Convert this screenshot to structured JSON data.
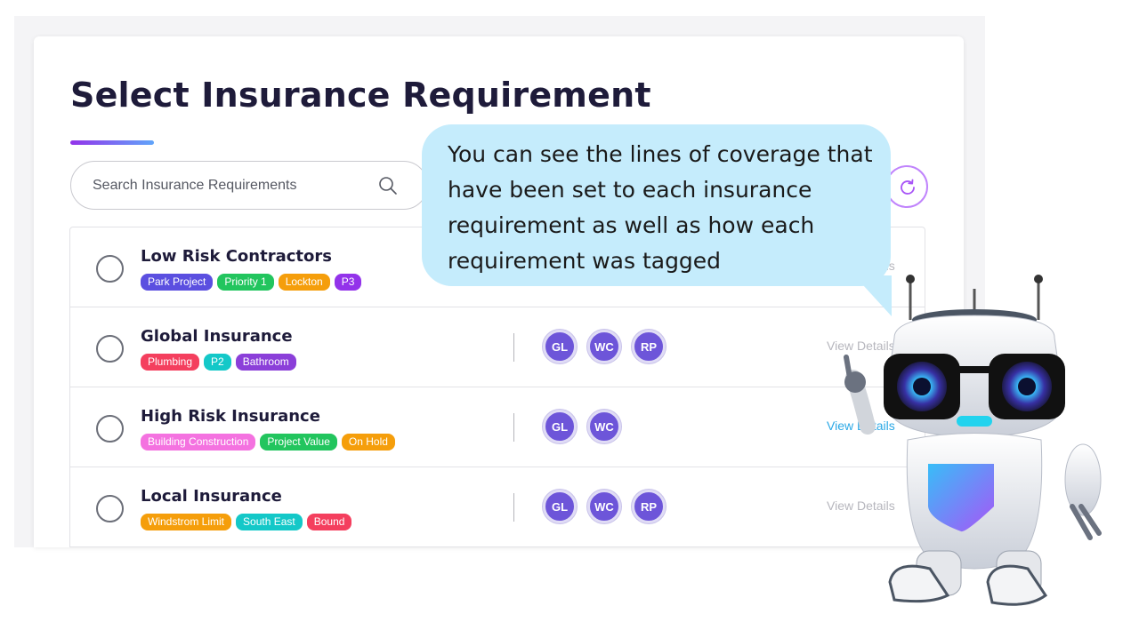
{
  "page": {
    "title": "Select Insurance Requirement",
    "search_placeholder": "Search Insurance Requirements"
  },
  "icons": {
    "search": "search-icon",
    "refresh": "refresh-icon",
    "mascot": "robot-mascot"
  },
  "rows": [
    {
      "name": "Low Risk Contractors",
      "tags": [
        {
          "label": "Park Project",
          "color": "#5b4fe0"
        },
        {
          "label": "Priority 1",
          "color": "#22c55e"
        },
        {
          "label": "Lockton",
          "color": "#f59e0b"
        },
        {
          "label": "P3",
          "color": "#9333ea"
        }
      ],
      "coverages": [],
      "view_label": "View Details"
    },
    {
      "name": "Global Insurance",
      "tags": [
        {
          "label": "Plumbing",
          "color": "#f43f5e"
        },
        {
          "label": "P2",
          "color": "#14c8c8"
        },
        {
          "label": "Bathroom",
          "color": "#8b3fd9"
        }
      ],
      "coverages": [
        "GL",
        "WC",
        "RP"
      ],
      "view_label": "View Details"
    },
    {
      "name": "High Risk Insurance",
      "tags": [
        {
          "label": "Building Construction",
          "color": "#f472e0"
        },
        {
          "label": "Project Value",
          "color": "#22c55e"
        },
        {
          "label": "On Hold",
          "color": "#f59e0b"
        }
      ],
      "coverages": [
        "GL",
        "WC"
      ],
      "view_label": "View Details"
    },
    {
      "name": "Local Insurance",
      "tags": [
        {
          "label": "Windstrom Limit",
          "color": "#f59e0b"
        },
        {
          "label": "South East",
          "color": "#14c8c8"
        },
        {
          "label": "Bound",
          "color": "#f43f5e"
        }
      ],
      "coverages": [
        "GL",
        "WC",
        "RP"
      ],
      "view_label": "View Details"
    }
  ],
  "tooltip": {
    "text": "You can see the lines of coverage that have been set to each insurance requirement as well as how each requirement was tagged"
  },
  "colors": {
    "accent_purple": "#9333ea",
    "accent_blue": "#60a5fa",
    "coverage_badge": "#6d55d9",
    "bubble": "#c5ecfc",
    "link": "#2aa8e6"
  }
}
